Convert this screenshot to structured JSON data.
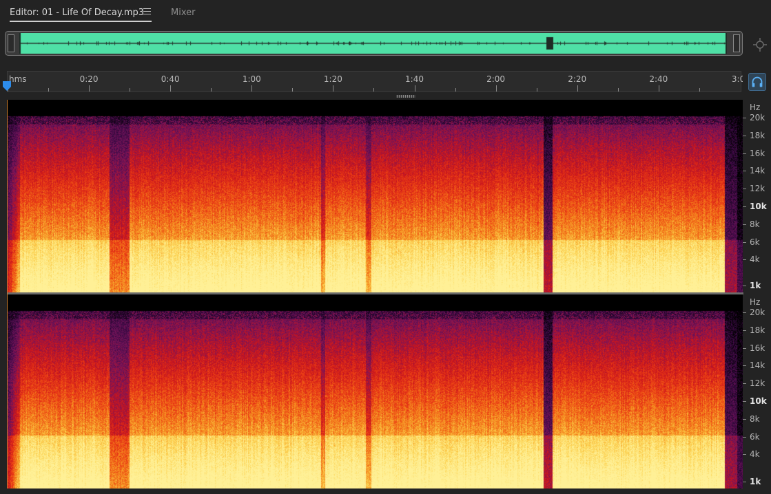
{
  "tabs": {
    "editor_label": "Editor: 01 - Life Of Decay.mp3",
    "mixer_label": "Mixer"
  },
  "ruler": {
    "unit": "hms",
    "duration_seconds": 183,
    "labels": [
      {
        "text": "0:20",
        "seconds": 20
      },
      {
        "text": "0:40",
        "seconds": 40
      },
      {
        "text": "1:00",
        "seconds": 60
      },
      {
        "text": "1:20",
        "seconds": 80
      },
      {
        "text": "1:40",
        "seconds": 100
      },
      {
        "text": "2:00",
        "seconds": 120
      },
      {
        "text": "2:20",
        "seconds": 140
      },
      {
        "text": "2:40",
        "seconds": 160
      },
      {
        "text": "3:00",
        "seconds": 180
      }
    ]
  },
  "frequency_scale": {
    "unit": "Hz",
    "labels": [
      {
        "text": "20k",
        "hz": 20000,
        "bold": false
      },
      {
        "text": "18k",
        "hz": 18000,
        "bold": false
      },
      {
        "text": "16k",
        "hz": 16000,
        "bold": false
      },
      {
        "text": "14k",
        "hz": 14000,
        "bold": false
      },
      {
        "text": "12k",
        "hz": 12000,
        "bold": false
      },
      {
        "text": "10k",
        "hz": 10000,
        "bold": true
      },
      {
        "text": "8k",
        "hz": 8000,
        "bold": false
      },
      {
        "text": "6k",
        "hz": 6000,
        "bold": false
      },
      {
        "text": "4k",
        "hz": 4000,
        "bold": false
      },
      {
        "text": "1k",
        "hz": 1000,
        "bold": true
      }
    ]
  },
  "colors": {
    "waveform": "#4fe0a6",
    "accent": "#2d8ceb",
    "playhead": "#2d8ceb"
  },
  "icons": {
    "tab_menu": "hamburger-icon",
    "zoom": "zoom-target-icon",
    "playhead": "playhead-icon",
    "headphones": "headphones-icon"
  }
}
